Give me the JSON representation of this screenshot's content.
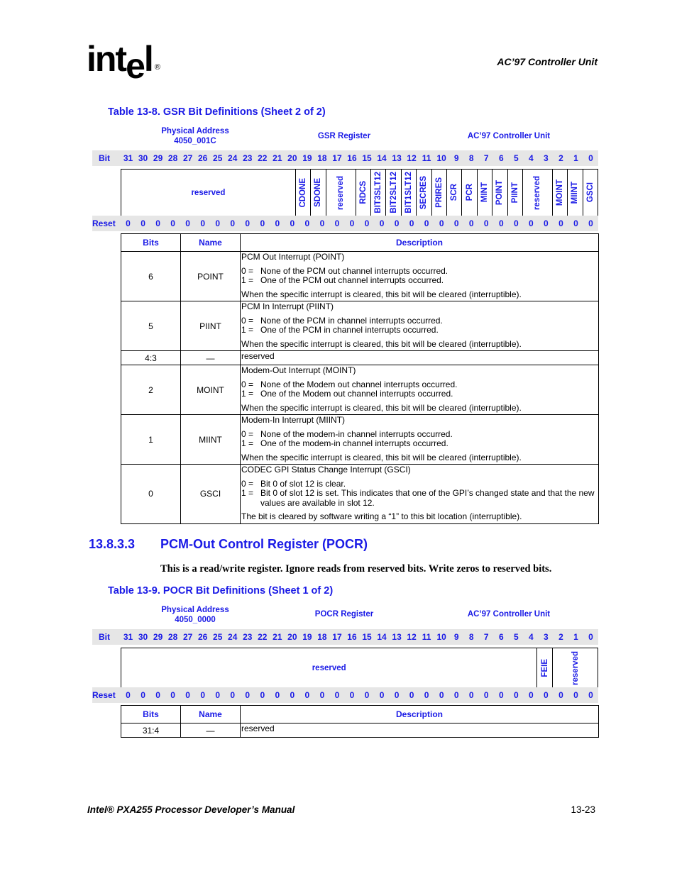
{
  "header": {
    "logo": {
      "text_a": "int",
      "text_e": "e",
      "text_b": "l",
      "reg": "®"
    },
    "section_title": "AC’97 Controller Unit"
  },
  "colors": {
    "accent_blue": "#1a1ae6",
    "bit_row_bg": "#e6e6e6"
  },
  "table1": {
    "title": "Table 13-8. GSR Bit Definitions (Sheet 2 of 2)",
    "phys_addr_label": "Physical Address",
    "phys_addr": "4050_001C",
    "register_name": "GSR Register",
    "unit": "AC’97 Controller Unit",
    "bit_label": "Bit",
    "reset_label": "Reset",
    "bits": [
      "31",
      "30",
      "29",
      "28",
      "27",
      "26",
      "25",
      "24",
      "23",
      "22",
      "21",
      "20",
      "19",
      "18",
      "17",
      "16",
      "15",
      "14",
      "13",
      "12",
      "11",
      "10",
      "9",
      "8",
      "7",
      "6",
      "5",
      "4",
      "3",
      "2",
      "1",
      "0"
    ],
    "reset": [
      "0",
      "0",
      "0",
      "0",
      "0",
      "0",
      "0",
      "0",
      "0",
      "0",
      "0",
      "0",
      "0",
      "0",
      "0",
      "0",
      "0",
      "0",
      "0",
      "0",
      "0",
      "0",
      "0",
      "0",
      "0",
      "0",
      "0",
      "0",
      "0",
      "0",
      "0",
      "0"
    ],
    "fields": [
      {
        "name": "reserved",
        "span": 12,
        "vertical": false
      },
      {
        "name": "CDONE",
        "span": 1,
        "vertical": true
      },
      {
        "name": "SDONE",
        "span": 1,
        "vertical": true
      },
      {
        "name": "reserved",
        "span": 2,
        "vertical": true
      },
      {
        "name": "RDCS",
        "span": 1,
        "vertical": true
      },
      {
        "name": "BIT3SLT12",
        "span": 1,
        "vertical": true
      },
      {
        "name": "BIT2SLT12",
        "span": 1,
        "vertical": true
      },
      {
        "name": "BIT1SLT12",
        "span": 1,
        "vertical": true
      },
      {
        "name": "SECRES",
        "span": 1,
        "vertical": true
      },
      {
        "name": "PRIRES",
        "span": 1,
        "vertical": true
      },
      {
        "name": "SCR",
        "span": 1,
        "vertical": true
      },
      {
        "name": "PCR",
        "span": 1,
        "vertical": true
      },
      {
        "name": "MINT",
        "span": 1,
        "vertical": true
      },
      {
        "name": "POINT",
        "span": 1,
        "vertical": true
      },
      {
        "name": "PIINT",
        "span": 1,
        "vertical": true
      },
      {
        "name": "reserved",
        "span": 2,
        "vertical": true
      },
      {
        "name": "MOINT",
        "span": 1,
        "vertical": true
      },
      {
        "name": "MIINT",
        "span": 1,
        "vertical": true
      },
      {
        "name": "GSCI",
        "span": 1,
        "vertical": true
      }
    ],
    "columns": [
      "Bits",
      "Name",
      "Description"
    ],
    "rows": [
      {
        "bits": "6",
        "name": "POINT",
        "title": "PCM Out Interrupt (POINT)",
        "opt0": "None of the PCM out channel interrupts occurred.",
        "opt1": "One of the PCM out channel interrupts occurred.",
        "note": "When the specific interrupt is cleared, this bit will be cleared (interruptible)."
      },
      {
        "bits": "5",
        "name": "PIINT",
        "title": "PCM In Interrupt (PIINT)",
        "opt0": "None of the PCM in channel interrupts occurred.",
        "opt1": "One of the PCM in channel interrupts occurred.",
        "note": "When the specific interrupt is cleared, this bit will be cleared (interruptible)."
      },
      {
        "bits": "4:3",
        "name": "—",
        "simple": "reserved"
      },
      {
        "bits": "2",
        "name": "MOINT",
        "title": "Modem-Out Interrupt (MOINT)",
        "opt0": "None of the Modem out channel interrupts occurred.",
        "opt1": "One of the Modem out channel interrupts occurred.",
        "note": "When the specific interrupt is cleared, this bit will be cleared (interruptible)."
      },
      {
        "bits": "1",
        "name": "MIINT",
        "title": "Modem-In Interrupt (MIINT)",
        "opt0": "None of the modem-in channel interrupts occurred.",
        "opt1": "One of the modem-in channel interrupts occurred.",
        "note": "When the specific interrupt is cleared, this bit will be cleared (interruptible)."
      },
      {
        "bits": "0",
        "name": "GSCI",
        "title": "CODEC GPI Status Change Interrupt (GSCI)",
        "opt0": "Bit 0 of slot 12 is clear.",
        "opt1": "Bit 0 of slot 12 is set. This indicates that one of the GPI’s changed state and that the new values are available in slot 12.",
        "note": "The bit is cleared by software writing a “1” to this bit location (interruptible)."
      }
    ],
    "opt0_key": "0 =",
    "opt1_key": "1 ="
  },
  "section": {
    "number": "13.8.3.3",
    "title": "PCM-Out Control Register (POCR)",
    "paragraph": "This is a read/write register. Ignore reads from reserved bits. Write zeros to reserved bits."
  },
  "table2": {
    "title": "Table 13-9. POCR Bit Definitions (Sheet 1 of 2)",
    "phys_addr_label": "Physical Address",
    "phys_addr": "4050_0000",
    "register_name": "POCR Register",
    "unit": "AC’97 Controller Unit",
    "bit_label": "Bit",
    "reset_label": "Reset",
    "bits": [
      "31",
      "30",
      "29",
      "28",
      "27",
      "26",
      "25",
      "24",
      "23",
      "22",
      "21",
      "20",
      "19",
      "18",
      "17",
      "16",
      "15",
      "14",
      "13",
      "12",
      "11",
      "10",
      "9",
      "8",
      "7",
      "6",
      "5",
      "4",
      "3",
      "2",
      "1",
      "0"
    ],
    "reset": [
      "0",
      "0",
      "0",
      "0",
      "0",
      "0",
      "0",
      "0",
      "0",
      "0",
      "0",
      "0",
      "0",
      "0",
      "0",
      "0",
      "0",
      "0",
      "0",
      "0",
      "0",
      "0",
      "0",
      "0",
      "0",
      "0",
      "0",
      "0",
      "0",
      "0",
      "0",
      "0"
    ],
    "fields": [
      {
        "name": "reserved",
        "span": 28,
        "vertical": false
      },
      {
        "name": "FEIE",
        "span": 1,
        "vertical": true
      },
      {
        "name": "reserved",
        "span": 3,
        "vertical": true
      }
    ],
    "columns": [
      "Bits",
      "Name",
      "Description"
    ],
    "rows": [
      {
        "bits": "31:4",
        "name": "—",
        "simple": "reserved"
      }
    ]
  },
  "footer": {
    "manual": "Intel® PXA255 Processor Developer’s Manual",
    "page": "13-23"
  }
}
